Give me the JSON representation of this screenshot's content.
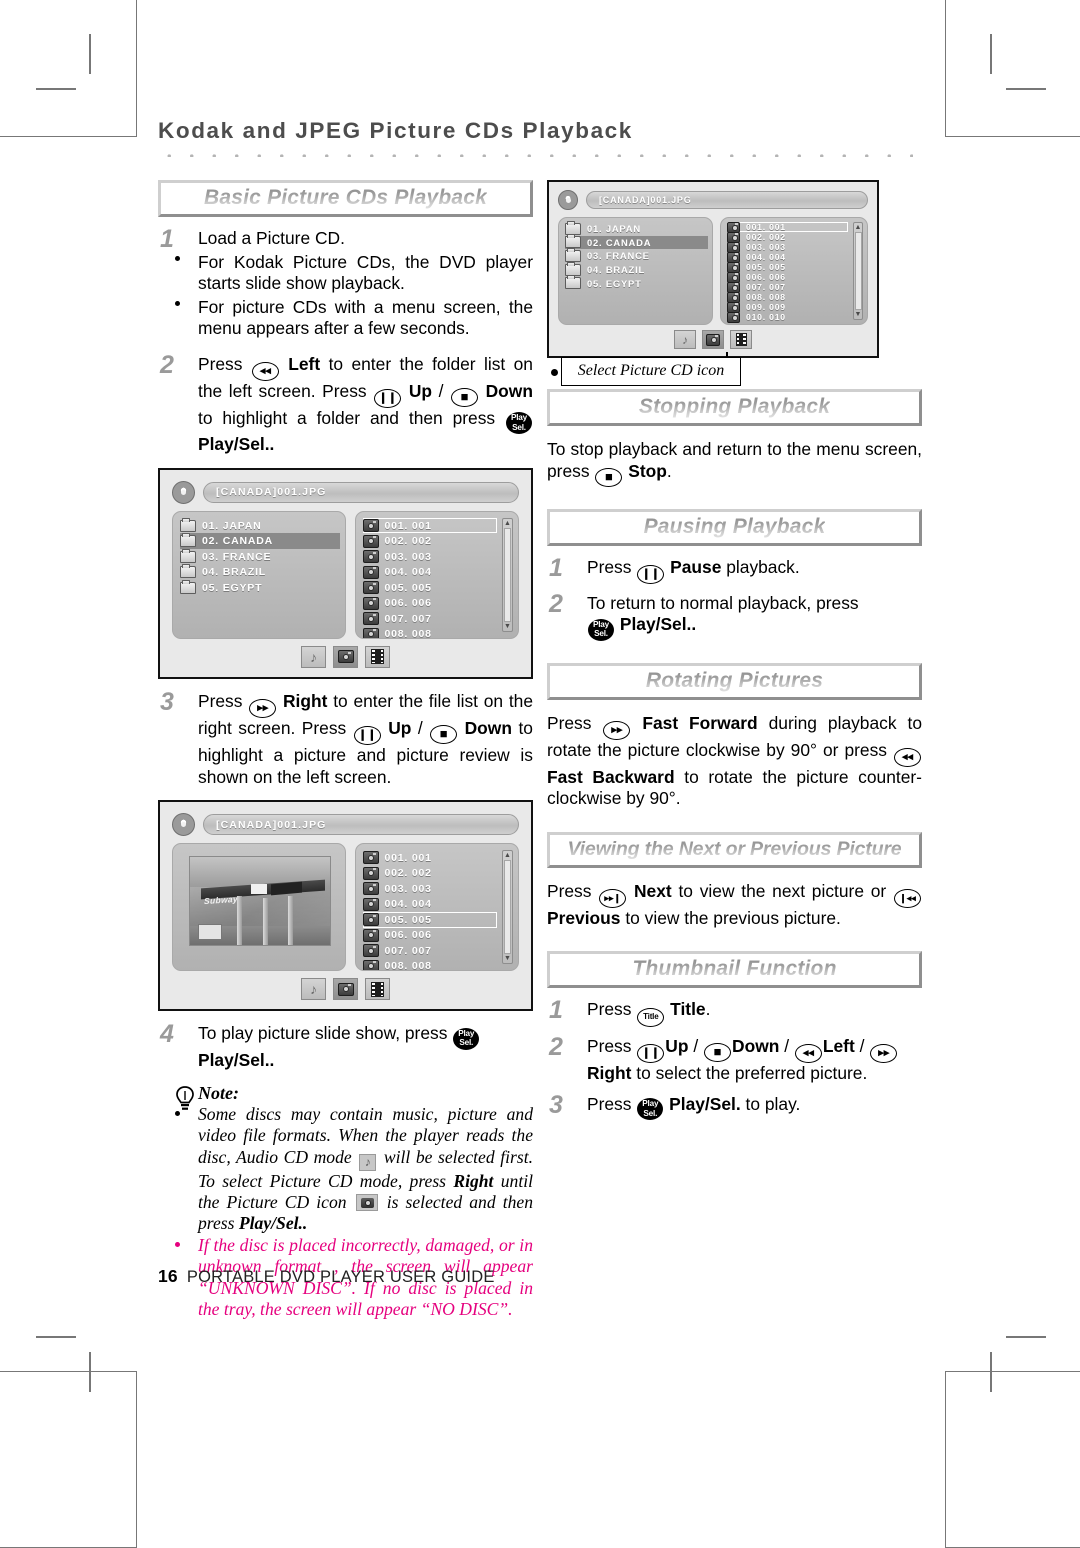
{
  "runhead": "Kodak and JPEG Picture CDs Playback",
  "footer": {
    "page": "16",
    "text": "PORTABLE DVD PLAYER USER GUIDE"
  },
  "keys": {
    "left": "◂◂",
    "right": "▸▸",
    "up": "❙❙",
    "down": "■",
    "stop": "■",
    "pause": "❙❙",
    "ff": "▸▸",
    "fb": "◂◂",
    "next": "▸▸❙",
    "prev": "❙◂◂",
    "title": "Title",
    "play_line1": "Play",
    "play_line2": "Sel."
  },
  "sections": {
    "basic": {
      "heading": "Basic Picture CDs Playback",
      "steps": [
        {
          "num": "1",
          "text": "Load a Picture CD."
        },
        {
          "num": "2",
          "text": "Press  Left to enter the folder list on the left screen. Press  Up /  Down to highlight a folder and then press  Play/Sel.."
        },
        {
          "num": "3",
          "text": "Press  Right to enter the file list on the right screen. Press  Up /  Down to highlight a picture and picture review is shown on the left screen."
        },
        {
          "num": "4",
          "text": "To play picture slide show, press  Play/Sel.."
        }
      ],
      "bullets": [
        "For Kodak Picture CDs, the DVD player starts slide show playback.",
        "For picture CDs with a menu screen, the menu appears after a few seconds."
      ],
      "step2": {
        "a": "Press",
        "b": "Left",
        "c": "to enter the folder list on the left screen. Press",
        "d": "Up",
        "sep": "/",
        "e": "Down",
        "f": "to highlight a folder and then press",
        "g": "Play/Sel.."
      },
      "step3": {
        "a": "Press",
        "b": "Right",
        "c": "to enter the file list on the right screen. Press",
        "d": "Up",
        "sep": "/",
        "e": "Down",
        "f": "to highlight a picture and picture review is shown on the left screen."
      },
      "step4": {
        "a": "To play picture slide show, press",
        "b": "Play/Sel.."
      }
    },
    "note": {
      "label": "Note:",
      "item1_a": "Some discs may contain music, picture and video file formats. When the player reads the disc, Audio CD mode",
      "item1_b": "will be selected first. To select Picture CD mode, press",
      "item1_bold": "Right",
      "item1_c": "until the Picture CD icon",
      "item1_d": "is selected and then press",
      "item1_e": "Play/Sel..",
      "item2": "If the disc is placed incorrectly, damaged, or in unknown format , the screen will appear “UNKNOWN DISC”. If no disc is placed in the tray, the screen will appear “NO DISC”."
    },
    "stopping": {
      "heading": "Stopping Playback",
      "a": "To stop playback and return to the menu screen, press",
      "b": "Stop",
      "c": "."
    },
    "pausing": {
      "heading": "Pausing Playback",
      "step1_a": "Press",
      "step1_b": "Pause",
      "step1_c": "playback.",
      "step2_a": "To return to normal playback, press",
      "step2_b": "Play/Sel.."
    },
    "rotating": {
      "heading": "Rotating Pictures",
      "a": "Press",
      "b": "Fast Forward",
      "c": "during playback to rotate the picture clockwise by 90° or press",
      "d": "Fast Backward",
      "e": "to rotate the picture counter-clockwise by 90°."
    },
    "viewing": {
      "heading": "Viewing the Next or Previous Picture",
      "a": "Press",
      "b": "Next",
      "c": "to view the next picture or",
      "d": "Previous",
      "e": "to view the previous picture."
    },
    "thumbnail": {
      "heading": "Thumbnail Function",
      "step1_a": "Press",
      "step1_b": "Title",
      "step1_c": ".",
      "step2_a": "Press",
      "step2_up": "Up",
      "step2_down": "Down",
      "step2_left": "Left",
      "step2_right": "Right",
      "step2_tail": "to select the preferred picture.",
      "step3_a": "Press",
      "step3_b": "Play/Sel.",
      "step3_c": "to play."
    }
  },
  "osd": {
    "title": "[CANADA]001.JPG",
    "folders": [
      {
        "label": "01. JAPAN",
        "selected": false
      },
      {
        "label": "02. CANADA",
        "selected": true
      },
      {
        "label": "03. FRANCE",
        "selected": false
      },
      {
        "label": "04. BRAZIL",
        "selected": false
      },
      {
        "label": "05. EGYPT",
        "selected": false
      }
    ],
    "files": [
      "001. 001",
      "002. 002",
      "003. 003",
      "004. 004",
      "005. 005",
      "006. 006",
      "007. 007",
      "008. 008",
      "009. 009",
      "010. 010"
    ],
    "file_selected_top": "001. 001",
    "file_selected_preview": "005. 005",
    "modes": [
      "music-mode",
      "picture-mode",
      "video-mode"
    ],
    "active_mode": "picture-mode",
    "preview_word": "Subway"
  },
  "callout": {
    "text": "Select Picture CD icon"
  }
}
